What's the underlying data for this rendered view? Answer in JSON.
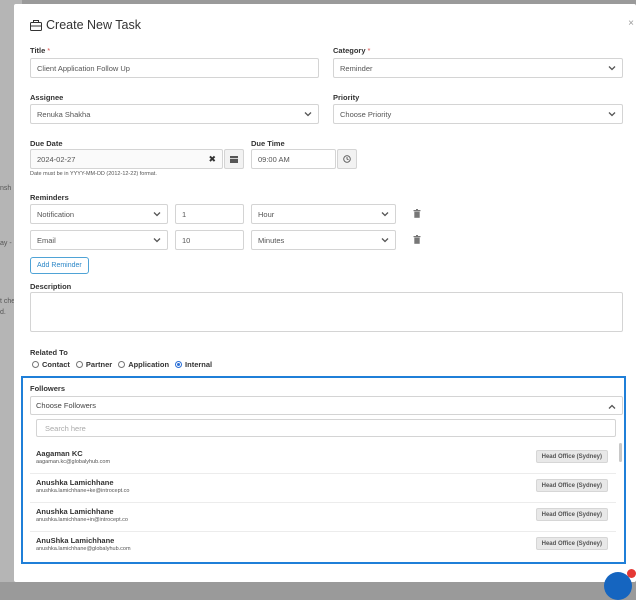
{
  "background": {
    "text_1": "nsh",
    "text_2": "ay -",
    "text_3": "t che",
    "text_4": "d."
  },
  "modal": {
    "title": "Create New Task",
    "close_label": "×",
    "title_field": {
      "label": "Title",
      "value": "Client Application Follow Up"
    },
    "category": {
      "label": "Category",
      "value": "Reminder"
    },
    "assignee": {
      "label": "Assignee",
      "value": "Renuka Shakha"
    },
    "priority": {
      "label": "Priority",
      "value": "Choose Priority"
    },
    "due_date": {
      "label": "Due Date",
      "value": "2024-02-27",
      "clear_label": "✖",
      "hint": "Date must be in YYYY-MM-DD (2012-12-22) format."
    },
    "due_time": {
      "label": "Due Time",
      "value": "09:00 AM"
    },
    "reminders": {
      "label": "Reminders",
      "rows": [
        {
          "type": "Notification",
          "amount": "1",
          "unit": "Hour"
        },
        {
          "type": "Email",
          "amount": "10",
          "unit": "Minutes"
        }
      ],
      "add_label": "Add Reminder"
    },
    "description": {
      "label": "Description",
      "value": ""
    },
    "related_to": {
      "label": "Related To",
      "options": [
        "Contact",
        "Partner",
        "Application",
        "Internal"
      ],
      "selected": "Internal"
    },
    "followers": {
      "label": "Followers",
      "placeholder": "Choose Followers",
      "search_placeholder": "Search here",
      "items": [
        {
          "name": "Aagaman KC",
          "email": "aagaman.kc@globalyhub.com",
          "office": "Head Office (Sydney)"
        },
        {
          "name": "Anushka Lamichhane",
          "email": "anushka.lamichhane+ke@introcept.co",
          "office": "Head Office (Sydney)"
        },
        {
          "name": "Anushka Lamichhane",
          "email": "anushka.lamichhane+in@introcept.co",
          "office": "Head Office (Sydney)"
        },
        {
          "name": "AnuShka Lamichhane",
          "email": "anushka.lamichhane@globalyhub.com",
          "office": "Head Office (Sydney)"
        }
      ]
    }
  },
  "colors": {
    "accent": "#1f7fd8",
    "required": "#d9534f",
    "link": "#2a86c7"
  }
}
